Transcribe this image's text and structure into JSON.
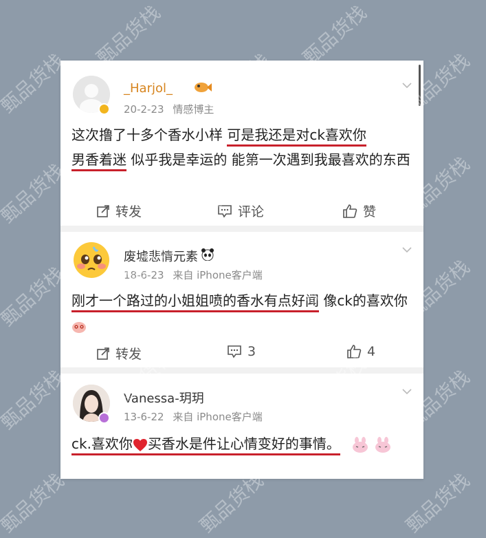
{
  "posts": [
    {
      "username": "_Harjol_",
      "date": "20-2-23",
      "tag": "情感博主",
      "text_before": "这次撸了十多个香水小样 ",
      "text_ul1": "可是我还是对ck喜欢你",
      "text_ul2": "男香着迷",
      "text_after": " 似乎我是幸运的 能第一次遇到我最喜欢的东西",
      "repost_label": "转发",
      "comment_label": "评论",
      "like_label": "赞"
    },
    {
      "username": "废墟悲情元素",
      "date": "18-6-23",
      "source": "来自 iPhone客户端",
      "text_ul": "刚才一个路过的小姐姐喷的香水有点好闻",
      "text_after": " 像ck的喜欢你",
      "repost_label": "转发",
      "comment_count": "3",
      "like_count": "4"
    },
    {
      "username": "Vanessa-玥玥",
      "date": "13-6-22",
      "source": "来自 iPhone客户端",
      "text_a": "ck.喜欢你",
      "text_b": "买香水是件让心情变好的事情。"
    }
  ],
  "watermark": "甄品货栈",
  "colors": {
    "background": "#8e9ba9",
    "underline": "#c8202b",
    "verified_gold": "#f2b51e",
    "verified_purple": "#b870d8"
  }
}
